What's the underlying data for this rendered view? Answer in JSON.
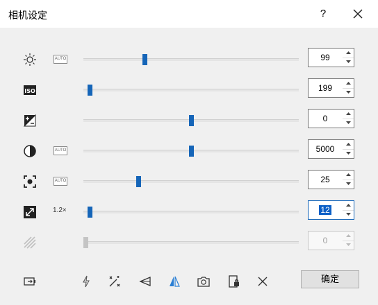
{
  "window": {
    "title": "相机设定",
    "help": "?"
  },
  "rows": [
    {
      "name": "brightness",
      "icon": "sun-icon",
      "auto": "AUTO",
      "slider_pct": 0.28,
      "value": "99"
    },
    {
      "name": "iso",
      "icon": "iso-icon",
      "iso_text": "ISO",
      "slider_pct": 0.02,
      "value": "199"
    },
    {
      "name": "exposure",
      "icon": "exposure-compensation-icon",
      "slider_pct": 0.5,
      "value": "0"
    },
    {
      "name": "contrast",
      "icon": "contrast-icon",
      "auto": "AUTO",
      "slider_pct": 0.5,
      "value": "5000"
    },
    {
      "name": "focus",
      "icon": "focus-icon",
      "auto": "AUTO",
      "slider_pct": 0.25,
      "value": "25"
    },
    {
      "name": "zoom",
      "icon": "zoom-icon",
      "zoom_label": "1.2×",
      "slider_pct": 0.02,
      "value": "12"
    },
    {
      "name": "disabled",
      "icon": "stripes-icon",
      "slider_pct": 0.0,
      "value": "0"
    }
  ],
  "bottom_toolbar": {
    "icons": [
      "battery-icon",
      "flash-icon",
      "magic-wand-icon",
      "triangle-flip-icon",
      "mirror-icon",
      "camera-rotate-icon",
      "lock-icon",
      "close-x-icon"
    ]
  },
  "ok_button": {
    "label": "确定"
  },
  "colors": {
    "accent": "#1565b8",
    "background": "#f0f0f0",
    "selection": "#0b5fc6"
  }
}
